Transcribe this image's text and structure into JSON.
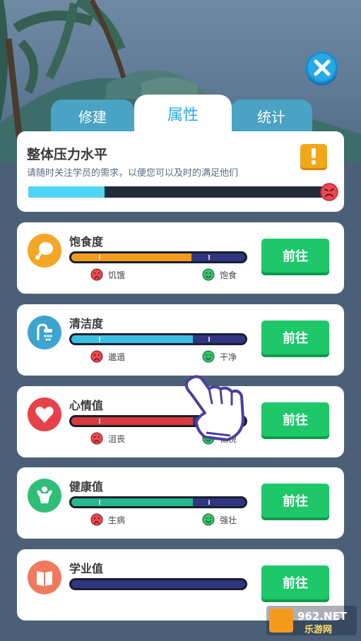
{
  "colors": {
    "accent": "#27a6e5",
    "go_button": "#1ec86a",
    "stress_fill": "#4fd6f7",
    "bar_track": "#2f3581",
    "sad_face": "#e8494f",
    "happy_face": "#37c36a"
  },
  "close_button": {
    "icon": "close-icon"
  },
  "tabs": [
    {
      "label": "修建",
      "active": false
    },
    {
      "label": "属性",
      "active": true
    },
    {
      "label": "统计",
      "active": false
    }
  ],
  "stress": {
    "title": "整体压力水平",
    "subtitle": "请随时关注学员的需求，以便您可以及时的满足他们",
    "level": 0.25,
    "icon": "alert-icon",
    "face": "angry-face-icon"
  },
  "attributes": [
    {
      "name": "饱食度",
      "icon": "drumstick-icon",
      "icon_color": "#f4a626",
      "fill_color": "#f59a20",
      "value": 0.69,
      "low_label": "饥饿",
      "high_label": "饱食",
      "button_label": "前往"
    },
    {
      "name": "清洁度",
      "icon": "shower-icon",
      "icon_color": "#3ea4cf",
      "fill_color": "#3bc0e4",
      "value": 0.7,
      "low_label": "邋遢",
      "high_label": "干净",
      "button_label": "前往"
    },
    {
      "name": "心情值",
      "icon": "heart-icon",
      "icon_color": "#e8414a",
      "fill_color": "#d93a3f",
      "value": 0.7,
      "low_label": "沮丧",
      "high_label": "愉悦",
      "button_label": "前往"
    },
    {
      "name": "健康值",
      "icon": "muscle-icon",
      "icon_color": "#2fbe78",
      "fill_color": "#27b98e",
      "value": 0.7,
      "low_label": "生病",
      "high_label": "强壮",
      "button_label": "前往"
    },
    {
      "name": "学业值",
      "icon": "book-icon",
      "icon_color": "#f07a5c",
      "fill_color": "#f07a5c",
      "value": 0.0,
      "low_label": "",
      "high_label": "",
      "button_label": "前往"
    }
  ],
  "watermark": {
    "brand_top": "962.NET",
    "brand_bottom": "乐游网"
  }
}
